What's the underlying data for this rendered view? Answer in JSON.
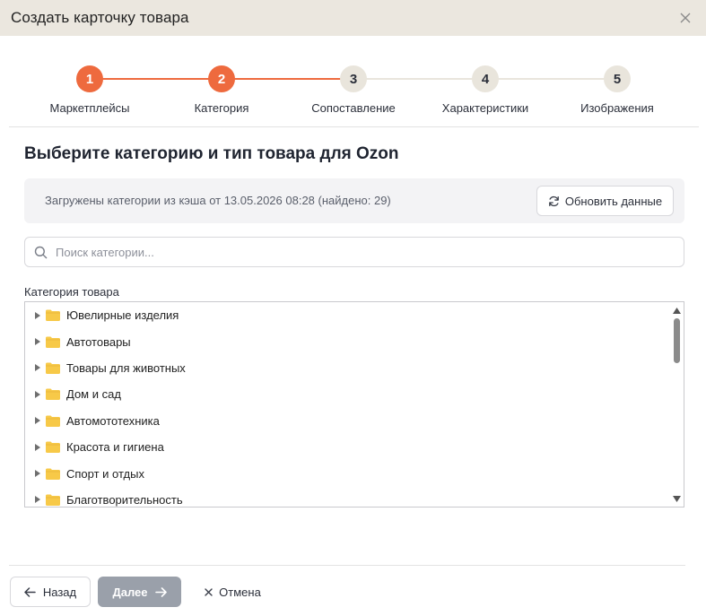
{
  "window": {
    "title": "Создать карточку товара",
    "close_icon": "close-icon"
  },
  "stepper": {
    "steps": [
      {
        "number": "1",
        "label": "Маркетплейсы",
        "state": "completed"
      },
      {
        "number": "2",
        "label": "Категория",
        "state": "current"
      },
      {
        "number": "3",
        "label": "Сопоставление",
        "state": "pending"
      },
      {
        "number": "4",
        "label": "Характеристики",
        "state": "pending"
      },
      {
        "number": "5",
        "label": "Изображения",
        "state": "pending"
      }
    ],
    "active_color": "#ee6a3e",
    "pending_color": "#e9e5dc"
  },
  "main": {
    "heading": "Выберите категорию и тип товара для Ozon",
    "cache_info": "Загружены категории из кэша от 13.05.2026 08:28 (найдено: 29)",
    "refresh_label": "Обновить данные",
    "search_placeholder": "Поиск категории...",
    "category_label": "Категория товара",
    "categories": [
      "Ювелирные изделия",
      "Автотовары",
      "Товары для животных",
      "Дом и сад",
      "Автомототехника",
      "Красота и гигиена",
      "Спорт и отдых",
      "Благотворительность"
    ]
  },
  "footer": {
    "back_label": "Назад",
    "next_label": "Далее",
    "cancel_label": "Отмена",
    "next_color": "#9aa0aa"
  }
}
